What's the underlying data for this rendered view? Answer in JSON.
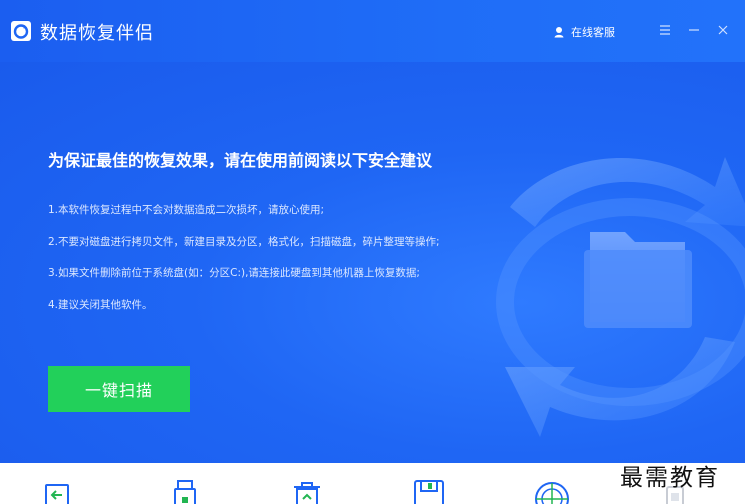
{
  "window": {
    "title": "数据恢复伴侣",
    "support_label": "在线客服"
  },
  "hero": {
    "headline": "为保证最佳的恢复效果，请在使用前阅读以下安全建议",
    "tips": [
      "1.本软件恢复过程中不会对数据造成二次损坏，请放心使用;",
      "2.不要对磁盘进行拷贝文件，新建目录及分区，格式化，扫描磁盘，碎片整理等操作;",
      "3.如果文件删除前位于系统盘(如：分区C:),请连接此硬盘到其他机器上恢复数据;",
      "4.建议关闭其他软件。"
    ],
    "scan_button_label": "一键扫描"
  },
  "watermark": "最需教育",
  "colors": {
    "brand_blue": "#1f66f4",
    "scan_green": "#22d05a"
  }
}
